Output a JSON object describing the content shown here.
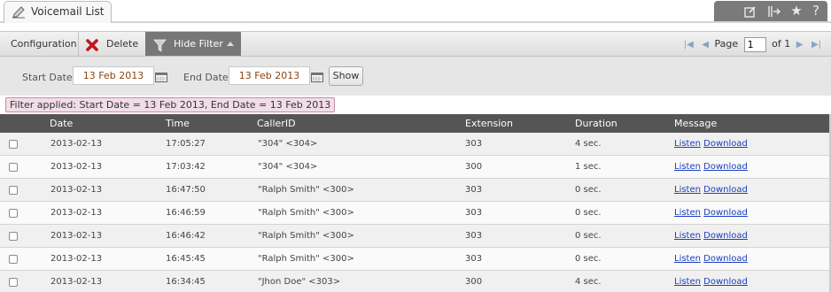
{
  "tab": {
    "title": "Voicemail List",
    "icon": "pencil-icon"
  },
  "window_controls": [
    {
      "icon": "edit-icon",
      "glyph": "☐"
    },
    {
      "icon": "dock-icon",
      "glyph": "|→"
    },
    {
      "icon": "star-icon",
      "glyph": "★"
    },
    {
      "icon": "help-icon",
      "glyph": "?"
    }
  ],
  "toolbar": {
    "configuration_label": "Configuration",
    "delete_label": "Delete",
    "hide_filter_label": "Hide Filter"
  },
  "pager": {
    "page_label": "Page",
    "page_value": "1",
    "of_label": "of 1"
  },
  "filter": {
    "start_label": "Start Date:",
    "start_value": "13 Feb 2013",
    "end_label": "End Date:",
    "end_value": "13 Feb 2013",
    "show_label": "Show",
    "applied_text": "Filter applied: Start Date = 13 Feb 2013, End Date = 13 Feb 2013"
  },
  "table": {
    "headers": [
      "Date",
      "Time",
      "CallerID",
      "Extension",
      "Duration",
      "Message"
    ],
    "listen_label": "Listen",
    "download_label": "Download",
    "rows": [
      {
        "date": "2013-02-13",
        "time": "17:05:27",
        "callerid": "\"304\" <304>",
        "extension": "303",
        "duration": "4 sec."
      },
      {
        "date": "2013-02-13",
        "time": "17:03:42",
        "callerid": "\"304\" <304>",
        "extension": "300",
        "duration": "1 sec."
      },
      {
        "date": "2013-02-13",
        "time": "16:47:50",
        "callerid": "\"Ralph Smith\" <300>",
        "extension": "303",
        "duration": "0 sec."
      },
      {
        "date": "2013-02-13",
        "time": "16:46:59",
        "callerid": "\"Ralph Smith\" <300>",
        "extension": "303",
        "duration": "0 sec."
      },
      {
        "date": "2013-02-13",
        "time": "16:46:42",
        "callerid": "\"Ralph Smith\" <300>",
        "extension": "303",
        "duration": "0 sec."
      },
      {
        "date": "2013-02-13",
        "time": "16:45:45",
        "callerid": "\"Ralph Smith\" <300>",
        "extension": "303",
        "duration": "0 sec."
      },
      {
        "date": "2013-02-13",
        "time": "16:34:45",
        "callerid": "\"Jhon Doe\" <303>",
        "extension": "300",
        "duration": "4 sec."
      }
    ]
  },
  "colors": {
    "header_bg": "#555555",
    "active_button_bg": "#777777",
    "link": "#1a3fbf",
    "date_text": "#8b4513",
    "filter_badge_bg": "#f2dde6"
  }
}
